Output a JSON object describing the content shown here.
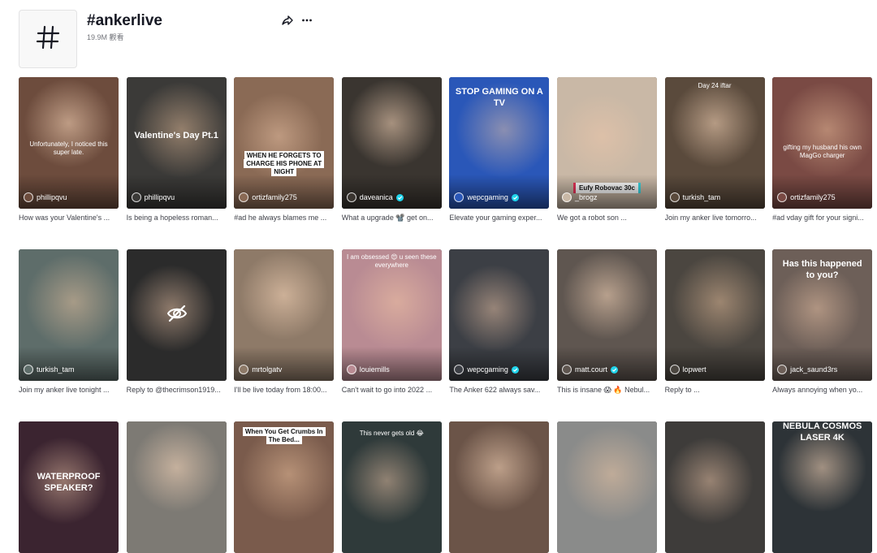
{
  "header": {
    "title": "#ankerlive",
    "views": "19.9M 觀看",
    "icons": [
      "hashtag-icon",
      "share-icon",
      "more-icon"
    ]
  },
  "rows": [
    [
      {
        "author": "phillipqvu",
        "caption": "How was your Valentine's ...",
        "overlay": "Unfortunately, I noticed this super late.",
        "bg": "#6d4c3d"
      },
      {
        "author": "phillipqvu",
        "caption": "Is being a hopeless roman...",
        "overlay": "Valentine's Day Pt.1",
        "bg": "#3b3a38"
      },
      {
        "author": "ortizfamily275",
        "caption": "#ad he always blames me ...",
        "overlay": "WHEN HE FORGETS TO CHARGE HIS PHONE AT NIGHT",
        "bg": "#8a6a55"
      },
      {
        "author": "daveanica",
        "caption": "What a upgrade 📽️ get on...",
        "overlay": "",
        "bg": "#3a3530"
      },
      {
        "author": "wepcgaming",
        "caption": "Elevate your gaming exper...",
        "overlay": "STOP GAMING ON A TV",
        "bg": "#2a57b8"
      },
      {
        "author": "_brogz",
        "caption": "We got a robot son ...",
        "overlay": "Eufy Robovac 30c",
        "bg": "#c9b8a6"
      },
      {
        "author": "turkish_tam",
        "caption": "Join my anker live tomorro...",
        "overlay": "Day 24 iftar",
        "bg": "#5a4a3c"
      },
      {
        "author": "ortizfamily275",
        "caption": "#ad vday gift for your signi...",
        "overlay": "gifting my husband his own MagGo charger",
        "bg": "#7a4a44"
      }
    ],
    [
      {
        "author": "turkish_tam",
        "caption": "Join my anker live tonight ...",
        "overlay": "",
        "bg": "#5e6d6a"
      },
      {
        "author": "",
        "caption": "Reply to @thecrimson1919...",
        "overlay": "",
        "bg": "#2b2b2b"
      },
      {
        "author": "mrtolgatv",
        "caption": "I'll be live today from 18:00...",
        "overlay": "",
        "bg": "#8e7a68"
      },
      {
        "author": "louiemills",
        "caption": "Can't wait to go into 2022 ...",
        "overlay": "I am obsessed 😍 u seen these everywhere",
        "bg": "#b98b93"
      },
      {
        "author": "wepcgaming",
        "caption": "The Anker 622 always sav...",
        "overlay": "",
        "bg": "#3c3f45"
      },
      {
        "author": "matt.court",
        "caption": "This is insane 😱 🔥 Nebul...",
        "overlay": "",
        "bg": "#5f5650"
      },
      {
        "author": "lopwert",
        "caption": "Reply to ...",
        "overlay": "",
        "bg": "#4b4640"
      },
      {
        "author": "jack_saund3rs",
        "caption": "Always annoying when yo...",
        "overlay": "Has this happened to you?",
        "bg": "#6d5f58"
      }
    ],
    [
      {
        "author": "",
        "caption": "",
        "overlay": "WATERPROOF SPEAKER?",
        "bg": "#3b2430"
      },
      {
        "author": "",
        "caption": "",
        "overlay": "",
        "bg": "#7d7a74"
      },
      {
        "author": "",
        "caption": "",
        "overlay": "When You Get Crumbs In The Bed...",
        "bg": "#7a5b4c"
      },
      {
        "author": "",
        "caption": "",
        "overlay": "This never gets old 😂",
        "bg": "#2f3a3a"
      },
      {
        "author": "",
        "caption": "",
        "overlay": "",
        "bg": "#6b5448"
      },
      {
        "author": "",
        "caption": "",
        "overlay": "",
        "bg": "#8a8b8a"
      },
      {
        "author": "",
        "caption": "",
        "overlay": "",
        "bg": "#3e3c3a"
      },
      {
        "author": "",
        "caption": "",
        "overlay": "NEBULA COSMOS LASER 4K",
        "bg": "#2d3337"
      }
    ]
  ]
}
